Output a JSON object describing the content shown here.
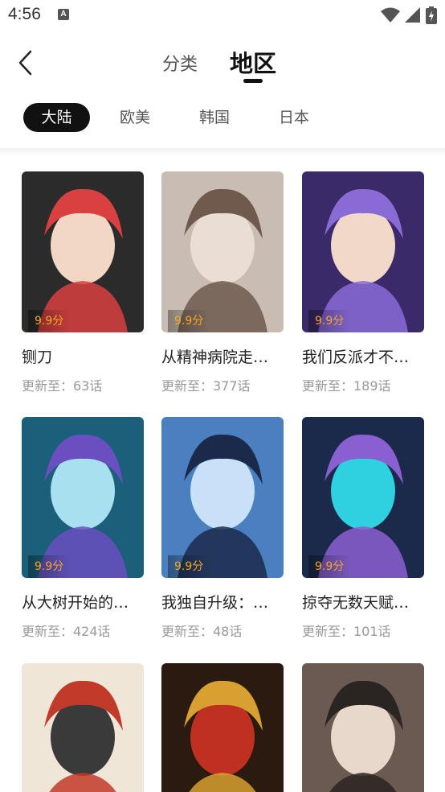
{
  "status_bar": {
    "time": "4:56",
    "notification_icon": "a-icon",
    "icons": [
      "wifi-icon",
      "signal-icon",
      "battery-icon"
    ]
  },
  "nav": {
    "tabs": [
      {
        "label": "分类",
        "active": false
      },
      {
        "label": "地区",
        "active": true
      }
    ]
  },
  "regions": [
    {
      "label": "大陆",
      "active": true
    },
    {
      "label": "欧美",
      "active": false
    },
    {
      "label": "韩国",
      "active": false
    },
    {
      "label": "日本",
      "active": false
    }
  ],
  "comics": [
    {
      "title": "铡刀",
      "update": "更新至：63话",
      "score": "9.9分",
      "palette": [
        "#2b2b2b",
        "#d94040",
        "#f2d7c4"
      ]
    },
    {
      "title": "从精神病院走…",
      "update": "更新至：377话",
      "score": "9.9分",
      "palette": [
        "#c9bcb3",
        "#6f5a4d",
        "#e9ddd4"
      ]
    },
    {
      "title": "我们反派才不…",
      "update": "更新至：189话",
      "score": "9.9分",
      "palette": [
        "#3a2a6a",
        "#8a6bd6",
        "#f1d8c8"
      ]
    },
    {
      "title": "从大树开始的…",
      "update": "更新至：424话",
      "score": "9.9分",
      "palette": [
        "#1b5f7a",
        "#6a4fc0",
        "#a8e0f0"
      ]
    },
    {
      "title": "我独自升级：…",
      "update": "更新至：48话",
      "score": "9.9分",
      "palette": [
        "#4a7fc0",
        "#1b2a4a",
        "#c8e0f8"
      ]
    },
    {
      "title": "掠夺无数天赋…",
      "update": "更新至：101话",
      "score": "9.9分",
      "palette": [
        "#1b2a4a",
        "#8a5fd0",
        "#2fd0e0"
      ]
    },
    {
      "title": "",
      "update": "",
      "score": "",
      "palette": [
        "#f0e6d8",
        "#c23a2a",
        "#3a3a3a"
      ]
    },
    {
      "title": "",
      "update": "",
      "score": "",
      "palette": [
        "#2a1a10",
        "#d8a030",
        "#c03020"
      ]
    },
    {
      "title": "",
      "update": "",
      "score": "",
      "palette": [
        "#6a5a52",
        "#2a2422",
        "#e8d8cc"
      ]
    }
  ]
}
